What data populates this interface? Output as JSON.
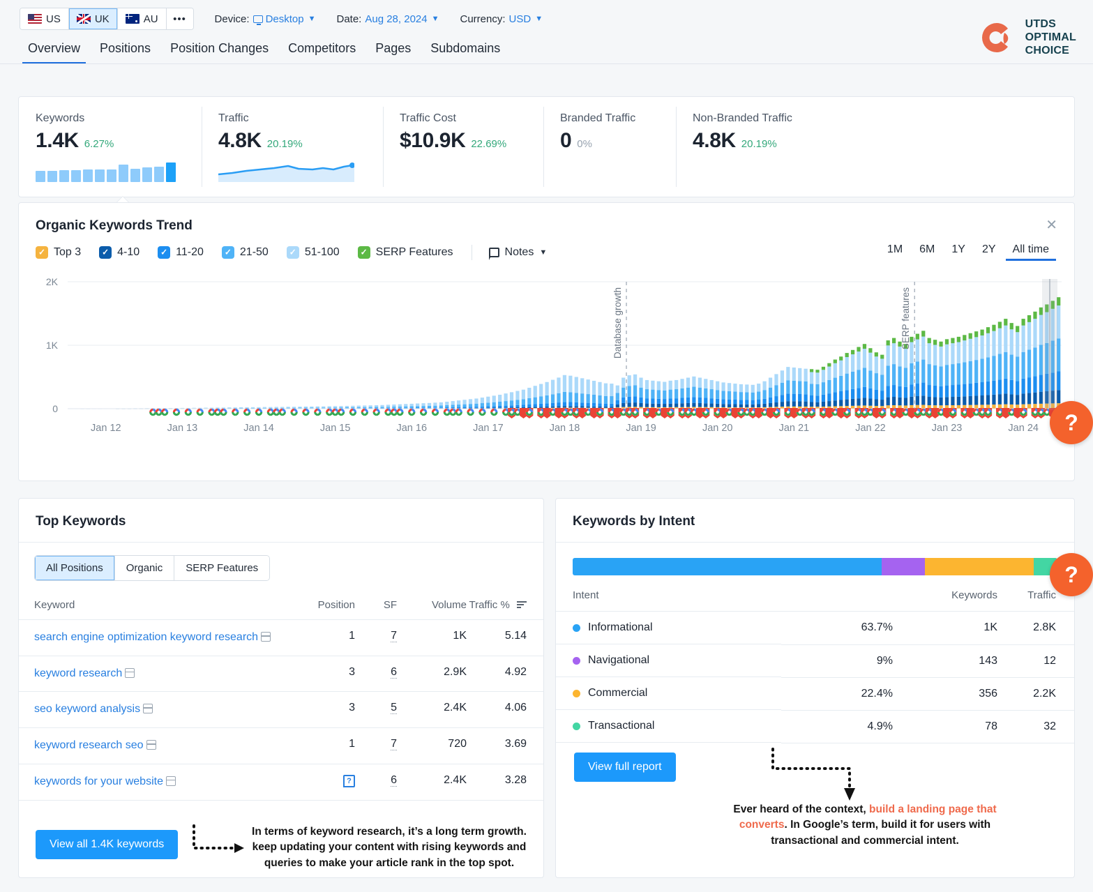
{
  "topbar": {
    "geo": [
      {
        "code": "US",
        "flag": "flag-us-icon",
        "active": false
      },
      {
        "code": "UK",
        "flag": "flag-uk-icon",
        "active": true
      },
      {
        "code": "AU",
        "flag": "flag-au-icon",
        "active": false
      }
    ],
    "more_label": "•••",
    "device": {
      "label": "Device:",
      "value": "Desktop"
    },
    "date": {
      "label": "Date:",
      "value": "Aug 28, 2024"
    },
    "currency": {
      "label": "Currency:",
      "value": "USD"
    },
    "logo": {
      "line1": "UTDS",
      "line2": "OPTIMAL",
      "line3": "CHOICE",
      "color": "#e8694a",
      "text_color": "#17424f"
    }
  },
  "tabs": [
    {
      "label": "Overview",
      "active": true
    },
    {
      "label": "Positions",
      "active": false
    },
    {
      "label": "Position Changes",
      "active": false
    },
    {
      "label": "Competitors",
      "active": false
    },
    {
      "label": "Pages",
      "active": false
    },
    {
      "label": "Subdomains",
      "active": false
    }
  ],
  "metrics": [
    {
      "label": "Keywords",
      "value": "1.4K",
      "delta": "6.27%",
      "delta_positive": true
    },
    {
      "label": "Traffic",
      "value": "4.8K",
      "delta": "20.19%",
      "delta_positive": true
    },
    {
      "label": "Traffic Cost",
      "value": "$10.9K",
      "delta": "22.69%",
      "delta_positive": true
    },
    {
      "label": "Branded Traffic",
      "value": "0",
      "delta": "0%",
      "delta_positive": false
    },
    {
      "label": "Non-Branded Traffic",
      "value": "4.8K",
      "delta": "20.19%",
      "delta_positive": true
    }
  ],
  "trend": {
    "title": "Organic Keywords Trend",
    "close_label": "✕",
    "legend": [
      {
        "label": "Top 3",
        "color": "#f5b33f"
      },
      {
        "label": "4-10",
        "color": "#0b5cab"
      },
      {
        "label": "11-20",
        "color": "#1c8ef0"
      },
      {
        "label": "21-50",
        "color": "#4fb3f7"
      },
      {
        "label": "51-100",
        "color": "#abd9fa"
      },
      {
        "label": "SERP Features",
        "color": "#5cb945"
      }
    ],
    "notes_label": "Notes",
    "ranges": [
      {
        "label": "1M",
        "active": false
      },
      {
        "label": "6M",
        "active": false
      },
      {
        "label": "1Y",
        "active": false
      },
      {
        "label": "2Y",
        "active": false
      },
      {
        "label": "All time",
        "active": true
      }
    ]
  },
  "chart_data": {
    "type": "bar",
    "title": "Organic Keywords Trend",
    "stacked": true,
    "xlabel": "",
    "ylabel": "",
    "ylim": [
      0,
      2000
    ],
    "yticks": [
      "0",
      "1K",
      "2K"
    ],
    "grid": true,
    "legend_position": "top-left",
    "x_tick_labels": [
      "Jan 12",
      "Jan 13",
      "Jan 14",
      "Jan 15",
      "Jan 16",
      "Jan 17",
      "Jan 18",
      "Jan 19",
      "Jan 20",
      "Jan 21",
      "Jan 22",
      "Jan 23",
      "Jan 24"
    ],
    "annotations": [
      {
        "label": "Database growth",
        "x_position": "Jan 19"
      },
      {
        "label": "SERP features",
        "x_position": "Jan 23"
      }
    ],
    "series": [
      {
        "name": "Top 3",
        "color": "#f5b33f"
      },
      {
        "name": "4-10",
        "color": "#0b5cab"
      },
      {
        "name": "11-20",
        "color": "#1c8ef0"
      },
      {
        "name": "21-50",
        "color": "#4fb3f7"
      },
      {
        "name": "51-100",
        "color": "#abd9fa"
      },
      {
        "name": "SERP Features",
        "color": "#5cb945"
      }
    ],
    "totals_by_index": [
      2,
      2,
      3,
      3,
      4,
      4,
      5,
      5,
      6,
      6,
      6,
      7,
      7,
      8,
      8,
      9,
      9,
      10,
      10,
      12,
      12,
      14,
      14,
      16,
      16,
      18,
      18,
      20,
      20,
      22,
      22,
      24,
      24,
      26,
      26,
      28,
      28,
      30,
      30,
      32,
      34,
      34,
      36,
      36,
      38,
      40,
      42,
      44,
      46,
      48,
      50,
      52,
      55,
      58,
      62,
      66,
      70,
      74,
      78,
      82,
      86,
      90,
      95,
      100,
      110,
      120,
      130,
      140,
      150,
      160,
      175,
      190,
      205,
      220,
      240,
      260,
      280,
      300,
      330,
      360,
      390,
      420,
      455,
      490,
      530,
      520,
      500,
      480,
      460,
      440,
      420,
      400,
      395,
      390,
      520,
      560,
      575,
      520,
      480,
      470,
      460,
      450,
      470,
      480,
      500,
      520,
      540,
      520,
      500,
      480,
      460,
      440,
      430,
      420,
      410,
      405,
      400,
      420,
      460,
      520,
      580,
      640,
      700,
      690,
      680,
      670,
      660,
      650,
      700,
      760,
      820,
      870,
      930,
      980,
      1030,
      1080,
      1010,
      940,
      900,
      1140,
      1180,
      1120,
      1080,
      1200,
      1250,
      1300,
      1180,
      1150,
      1120,
      1160,
      1180,
      1200,
      1230,
      1260,
      1290,
      1320,
      1360,
      1400,
      1450,
      1500,
      1430,
      1380,
      1500,
      1560,
      1620,
      1690,
      1740,
      1800,
      1860
    ]
  },
  "top_keywords": {
    "title": "Top Keywords",
    "segments": [
      {
        "label": "All Positions",
        "active": true
      },
      {
        "label": "Organic",
        "active": false
      },
      {
        "label": "SERP Features",
        "active": false
      }
    ],
    "columns": [
      "Keyword",
      "Position",
      "SF",
      "Volume",
      "Traffic %"
    ],
    "rows": [
      {
        "keyword": "search engine optimization keyword research",
        "has_serp_icon": true,
        "position": "1",
        "position_is_feature": false,
        "sf": "7",
        "volume": "1K",
        "traffic": "5.14"
      },
      {
        "keyword": "keyword research",
        "has_serp_icon": true,
        "position": "3",
        "position_is_feature": false,
        "sf": "6",
        "volume": "2.9K",
        "traffic": "4.92"
      },
      {
        "keyword": "seo keyword analysis",
        "has_serp_icon": true,
        "position": "3",
        "position_is_feature": false,
        "sf": "5",
        "volume": "2.4K",
        "traffic": "4.06"
      },
      {
        "keyword": "keyword research seo",
        "has_serp_icon": true,
        "position": "1",
        "position_is_feature": false,
        "sf": "7",
        "volume": "720",
        "traffic": "3.69"
      },
      {
        "keyword": "keywords for your website",
        "has_serp_icon": true,
        "position": "",
        "position_is_feature": true,
        "sf": "6",
        "volume": "2.4K",
        "traffic": "3.28"
      }
    ],
    "view_all_label": "View all 1.4K keywords",
    "annotation": "In terms of keyword research, it’s a long term growth. keep updating your content with rising keywords and queries to make your article rank in the top spot."
  },
  "keywords_by_intent": {
    "title": "Keywords by Intent",
    "columns": [
      "Intent",
      "Keywords",
      "Traffic"
    ],
    "rows": [
      {
        "intent": "Informational",
        "color": "#29a3f5",
        "percent": "63.7%",
        "keywords": "1K",
        "traffic": "2.8K",
        "width": 63.7
      },
      {
        "intent": "Navigational",
        "color": "#a563f0",
        "percent": "9%",
        "keywords": "143",
        "traffic": "12",
        "width": 9.0
      },
      {
        "intent": "Commercial",
        "color": "#fcb530",
        "percent": "22.4%",
        "keywords": "356",
        "traffic": "2.2K",
        "width": 22.4
      },
      {
        "intent": "Transactional",
        "color": "#43d6a3",
        "percent": "4.9%",
        "keywords": "78",
        "traffic": "32",
        "width": 4.9
      }
    ],
    "view_report_label": "View full report",
    "annotation_part1": "Ever heard of the context, ",
    "annotation_hl1": "build a landing page that converts",
    "annotation_part2": ". In Google’s term, build it for users with transactional and commercial intent."
  },
  "help_buttons": {
    "glyph": "?",
    "color": "#f4622c"
  }
}
